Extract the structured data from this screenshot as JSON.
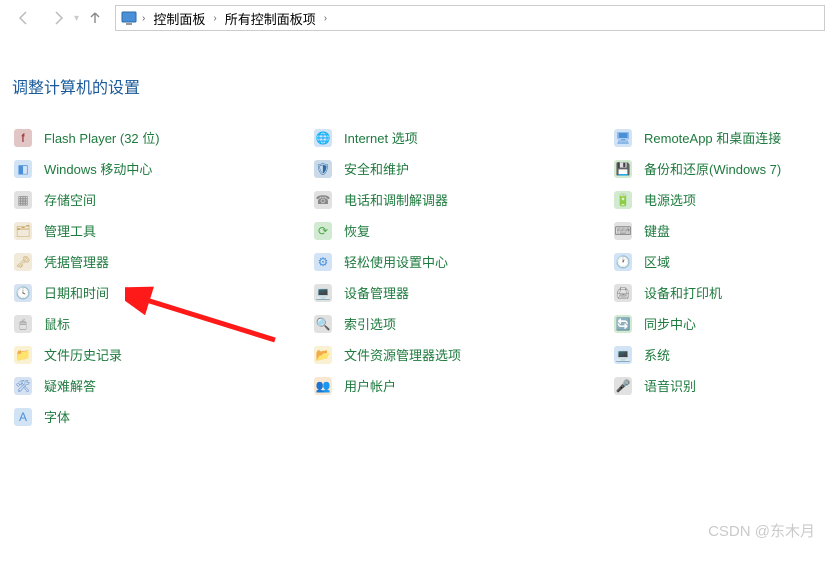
{
  "breadcrumbs": {
    "item1": "控制面板",
    "item2": "所有控制面板项"
  },
  "heading": "调整计算机的设置",
  "watermark": "CSDN @东木月",
  "columns": [
    [
      {
        "id": "flash-player",
        "label": "Flash Player (32 位)",
        "iconFill": "#8b1a1a",
        "iconText": "f"
      },
      {
        "id": "mobility-center",
        "label": "Windows 移动中心",
        "iconFill": "#4a90d9",
        "iconText": "◧"
      },
      {
        "id": "storage-spaces",
        "label": "存储空间",
        "iconFill": "#888",
        "iconText": "▦"
      },
      {
        "id": "admin-tools",
        "label": "管理工具",
        "iconFill": "#c9a868",
        "iconText": "🗂"
      },
      {
        "id": "credential-manager",
        "label": "凭据管理器",
        "iconFill": "#c9a868",
        "iconText": "🗝"
      },
      {
        "id": "date-time",
        "label": "日期和时间",
        "iconFill": "#5b8ac9",
        "iconText": "🕓"
      },
      {
        "id": "mouse",
        "label": "鼠标",
        "iconFill": "#888",
        "iconText": "🖱"
      },
      {
        "id": "file-history",
        "label": "文件历史记录",
        "iconFill": "#e6c84a",
        "iconText": "📁"
      },
      {
        "id": "troubleshooting",
        "label": "疑难解答",
        "iconFill": "#5b8ac9",
        "iconText": "🛠"
      },
      {
        "id": "fonts",
        "label": "字体",
        "iconFill": "#4a90d9",
        "iconText": "A"
      }
    ],
    [
      {
        "id": "internet-options",
        "label": "Internet 选项",
        "iconFill": "#4a90d9",
        "iconText": "🌐"
      },
      {
        "id": "security-maintenance",
        "label": "安全和维护",
        "iconFill": "#2a6aa8",
        "iconText": "🛡"
      },
      {
        "id": "phone-modem",
        "label": "电话和调制解调器",
        "iconFill": "#888",
        "iconText": "☎"
      },
      {
        "id": "recovery",
        "label": "恢复",
        "iconFill": "#4aa84a",
        "iconText": "⟳"
      },
      {
        "id": "ease-of-access",
        "label": "轻松使用设置中心",
        "iconFill": "#4a90d9",
        "iconText": "⚙"
      },
      {
        "id": "device-manager",
        "label": "设备管理器",
        "iconFill": "#888",
        "iconText": "💻"
      },
      {
        "id": "indexing-options",
        "label": "索引选项",
        "iconFill": "#888",
        "iconText": "🔍"
      },
      {
        "id": "file-explorer-options",
        "label": "文件资源管理器选项",
        "iconFill": "#e6c84a",
        "iconText": "📂"
      },
      {
        "id": "user-accounts",
        "label": "用户帐户",
        "iconFill": "#e0a050",
        "iconText": "👥"
      }
    ],
    [
      {
        "id": "remoteapp",
        "label": "RemoteApp 和桌面连接",
        "iconFill": "#4a90d9",
        "iconText": "🖥"
      },
      {
        "id": "backup-restore",
        "label": "备份和还原(Windows 7)",
        "iconFill": "#4aa84a",
        "iconText": "💾"
      },
      {
        "id": "power-options",
        "label": "电源选项",
        "iconFill": "#4aa84a",
        "iconText": "🔋"
      },
      {
        "id": "keyboard",
        "label": "键盘",
        "iconFill": "#888",
        "iconText": "⌨"
      },
      {
        "id": "region",
        "label": "区域",
        "iconFill": "#4a90d9",
        "iconText": "🕐"
      },
      {
        "id": "devices-printers",
        "label": "设备和打印机",
        "iconFill": "#888",
        "iconText": "🖨"
      },
      {
        "id": "sync-center",
        "label": "同步中心",
        "iconFill": "#4aa84a",
        "iconText": "🔄"
      },
      {
        "id": "system",
        "label": "系统",
        "iconFill": "#4a90d9",
        "iconText": "💻"
      },
      {
        "id": "speech-recognition",
        "label": "语音识别",
        "iconFill": "#888",
        "iconText": "🎤"
      }
    ]
  ]
}
